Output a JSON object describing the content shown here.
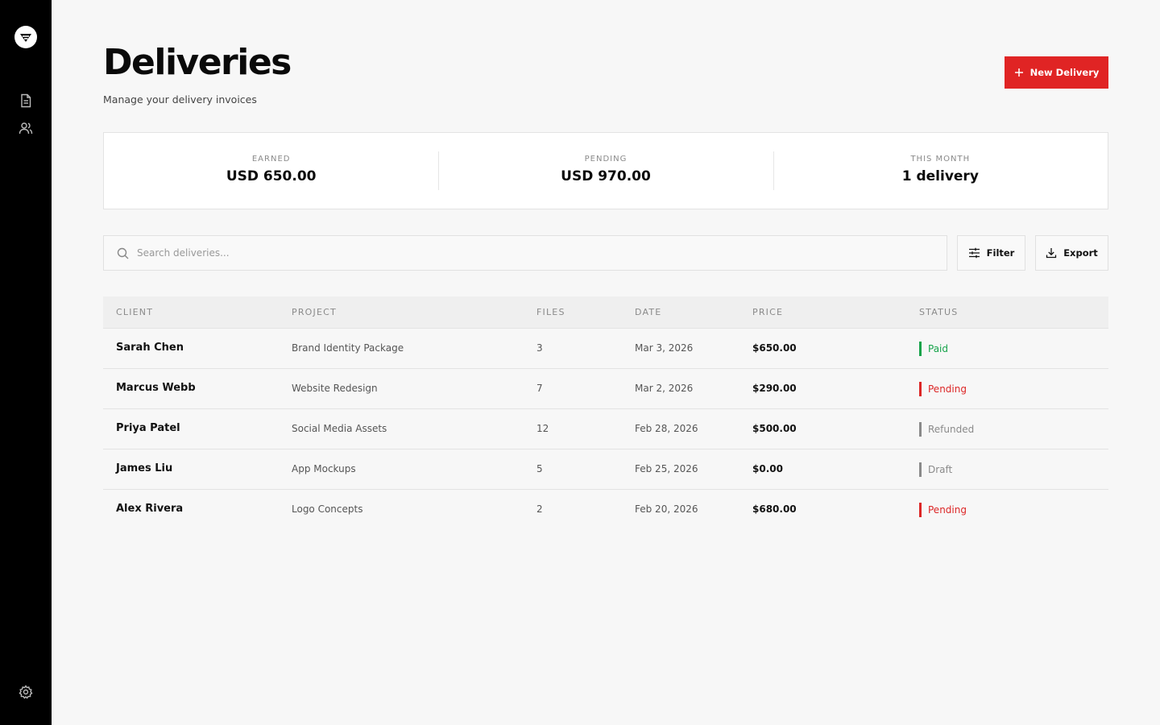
{
  "page": {
    "title": "Deliveries",
    "subtitle": "Manage your delivery invoices",
    "new_button_label": "New Delivery"
  },
  "sidebar": {
    "items": [
      {
        "icon": "document-icon"
      },
      {
        "icon": "users-icon"
      }
    ],
    "bottom_icon": "gear-icon"
  },
  "stats": [
    {
      "label": "EARNED",
      "value": "USD 650.00"
    },
    {
      "label": "PENDING",
      "value": "USD 970.00"
    },
    {
      "label": "THIS MONTH",
      "value": "1 delivery"
    }
  ],
  "search": {
    "placeholder": "Search deliveries..."
  },
  "toolbar": {
    "filter_label": "Filter",
    "export_label": "Export"
  },
  "table": {
    "headers": [
      "CLIENT",
      "PROJECT",
      "FILES",
      "DATE",
      "PRICE",
      "STATUS"
    ],
    "rows": [
      {
        "client": "Sarah Chen",
        "project": "Brand Identity Package",
        "files": "3",
        "date": "Mar 3, 2026",
        "price": "$650.00",
        "status": "Paid"
      },
      {
        "client": "Marcus Webb",
        "project": "Website Redesign",
        "files": "7",
        "date": "Mar 2, 2026",
        "price": "$290.00",
        "status": "Pending"
      },
      {
        "client": "Priya Patel",
        "project": "Social Media Assets",
        "files": "12",
        "date": "Feb 28, 2026",
        "price": "$500.00",
        "status": "Refunded"
      },
      {
        "client": "James Liu",
        "project": "App Mockups",
        "files": "5",
        "date": "Feb 25, 2026",
        "price": "$0.00",
        "status": "Draft"
      },
      {
        "client": "Alex Rivera",
        "project": "Logo Concepts",
        "files": "2",
        "date": "Feb 20, 2026",
        "price": "$680.00",
        "status": "Pending"
      }
    ]
  },
  "colors": {
    "accent": "#e02424",
    "paid": "#16a34a",
    "pending": "#dc2626",
    "muted": "#8a8a8a"
  }
}
